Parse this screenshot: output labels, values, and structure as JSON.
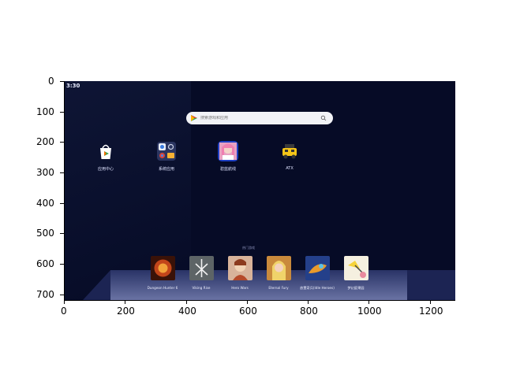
{
  "status": {
    "time": "3:30"
  },
  "search": {
    "placeholder": "搜索游戏和应用"
  },
  "apps": [
    {
      "label": "应用中心",
      "icon": "play-store-bag-icon"
    },
    {
      "label": "系统应用",
      "icon": "system-apps-folder-icon"
    },
    {
      "label": "碧蓝航线",
      "icon": "azur-lane-icon"
    },
    {
      "label": "ATX",
      "icon": "atx-robot-icon"
    }
  ],
  "popular_label": "热门游戏",
  "games": [
    {
      "label": "Dungeon Hunter 6"
    },
    {
      "label": "Viking Rise"
    },
    {
      "label": "Hero Wars"
    },
    {
      "label": "Eternal Fury"
    },
    {
      "label": "放置奇兵(Idle Heroes)"
    },
    {
      "label": "梦幻庭果园"
    }
  ],
  "axes": {
    "y_ticks": [
      "0",
      "100",
      "200",
      "300",
      "400",
      "500",
      "600",
      "700"
    ],
    "x_ticks": [
      "0",
      "200",
      "400",
      "600",
      "800",
      "1000",
      "1200"
    ]
  },
  "colors": {
    "desktop_bg": "#060b26",
    "search_bg": "#f2f3f7"
  }
}
